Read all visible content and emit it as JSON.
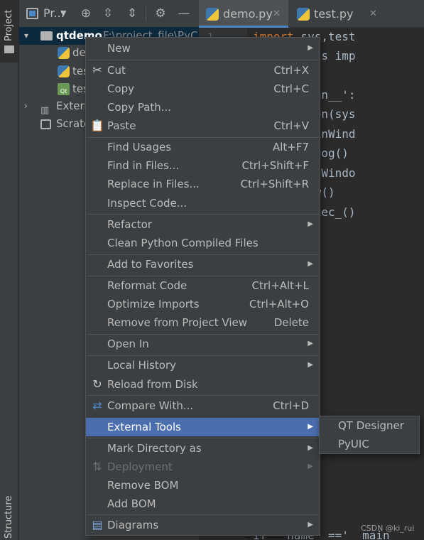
{
  "side_strip": {
    "project_tab": "Project",
    "structure_tab": "Structure"
  },
  "project_panel": {
    "title": "Pr...",
    "tree": [
      {
        "label": "qtdemo",
        "path": "F:\\project_file\\PyC"
      },
      {
        "label": "de"
      },
      {
        "label": "tes"
      },
      {
        "label": "tes"
      },
      {
        "label": "Extern"
      },
      {
        "label": "Scrato"
      }
    ]
  },
  "editor": {
    "tabs": [
      {
        "label": "demo.py",
        "active": true
      },
      {
        "label": "test.py",
        "active": false
      }
    ],
    "gutter_first": "1",
    "lines": [
      {
        "kw": "import",
        "rest": " sys,test"
      },
      {
        "kw": "",
        "rest": "5.QtWidgets imp"
      },
      {
        "kw": "",
        "rest": ""
      },
      {
        "kw": "",
        "rest": "__=='__main__':"
      },
      {
        "kw": "",
        "rest": "Application(sys"
      },
      {
        "kw": "",
        "rest": "indow=QMainWind"
      },
      {
        "kw": "",
        "rest": "st.Ui_Dialog()"
      },
      {
        "kw": "",
        "rest": "tupUi(MainWindo"
      },
      {
        "kw": "",
        "rest": "indow.show()"
      },
      {
        "kw": "",
        "rest": "xit(app.exec_()"
      }
    ],
    "bottom_line": "if __name__=='__main"
  },
  "context_menu": {
    "items": [
      {
        "label": "New",
        "shortcut": "",
        "submenu": true
      },
      {
        "label": "Cut",
        "shortcut": "Ctrl+X",
        "icon": "scissors-icon"
      },
      {
        "label": "Copy",
        "shortcut": "Ctrl+C"
      },
      {
        "label": "Copy Path...",
        "shortcut": ""
      },
      {
        "label": "Paste",
        "shortcut": "Ctrl+V",
        "icon": "clipboard-icon"
      },
      {
        "label": "Find Usages",
        "shortcut": "Alt+F7"
      },
      {
        "label": "Find in Files...",
        "shortcut": "Ctrl+Shift+F"
      },
      {
        "label": "Replace in Files...",
        "shortcut": "Ctrl+Shift+R"
      },
      {
        "label": "Inspect Code...",
        "shortcut": ""
      },
      {
        "label": "Refactor",
        "shortcut": "",
        "submenu": true
      },
      {
        "label": "Clean Python Compiled Files",
        "shortcut": ""
      },
      {
        "label": "Add to Favorites",
        "shortcut": "",
        "submenu": true
      },
      {
        "label": "Reformat Code",
        "shortcut": "Ctrl+Alt+L"
      },
      {
        "label": "Optimize Imports",
        "shortcut": "Ctrl+Alt+O"
      },
      {
        "label": "Remove from Project View",
        "shortcut": "Delete"
      },
      {
        "label": "Open In",
        "shortcut": "",
        "submenu": true
      },
      {
        "label": "Local History",
        "shortcut": "",
        "submenu": true
      },
      {
        "label": "Reload from Disk",
        "shortcut": "",
        "icon": "reload-icon"
      },
      {
        "label": "Compare With...",
        "shortcut": "Ctrl+D",
        "icon": "compare-icon"
      },
      {
        "label": "External Tools",
        "shortcut": "",
        "submenu": true,
        "highlighted": true
      },
      {
        "label": "Mark Directory as",
        "shortcut": "",
        "submenu": true
      },
      {
        "label": "Deployment",
        "shortcut": "",
        "submenu": true,
        "disabled": true,
        "icon": "deployment-icon"
      },
      {
        "label": "Remove BOM",
        "shortcut": ""
      },
      {
        "label": "Add BOM",
        "shortcut": ""
      },
      {
        "label": "Diagrams",
        "shortcut": "",
        "submenu": true,
        "icon": "diagram-icon"
      }
    ]
  },
  "external_tools_submenu": {
    "items": [
      "QT Designer",
      "PyUIC"
    ]
  },
  "watermark": "CSDN @ki_rui",
  "colors": {
    "background": "#2b2b2b",
    "panel": "#3c3f41",
    "highlight": "#4b6eaf",
    "selection": "#0d293e",
    "keyword": "#cc7832"
  }
}
